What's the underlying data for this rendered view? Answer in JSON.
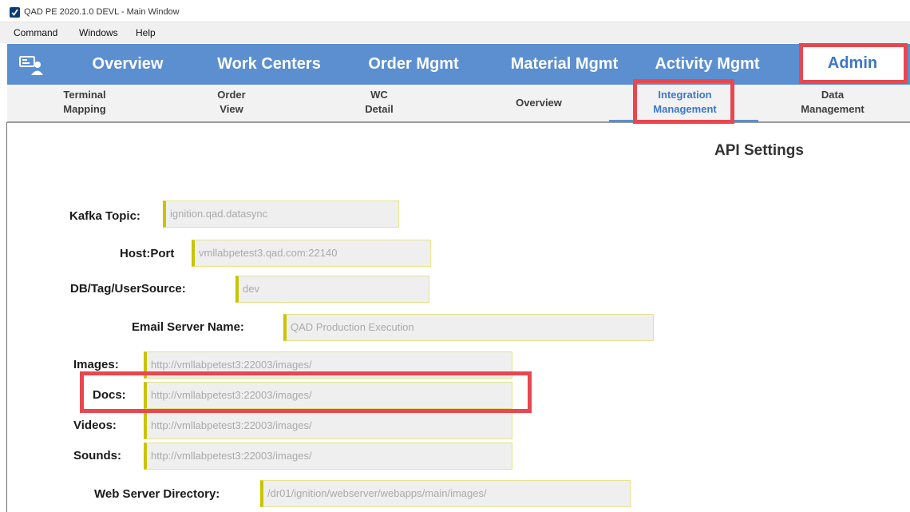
{
  "window": {
    "title": "QAD PE 2020.1.0 DEVL - Main Window"
  },
  "menu": [
    "Command",
    "Windows",
    "Help"
  ],
  "top_nav": {
    "tabs": [
      "Overview",
      "Work Centers",
      "Order Mgmt",
      "Material Mgmt",
      "Activity Mgmt"
    ],
    "active": "Admin"
  },
  "sub_nav": {
    "tabs": [
      {
        "line1": "Terminal",
        "line2": "Mapping"
      },
      {
        "line1": "Order",
        "line2": "View"
      },
      {
        "line1": "WC",
        "line2": "Detail"
      },
      {
        "line1": "Overview",
        "line2": ""
      },
      {
        "line1": "Integration",
        "line2": "Management"
      },
      {
        "line1": "Data",
        "line2": "Management"
      }
    ],
    "active_index": 4
  },
  "page": {
    "title": "API Settings"
  },
  "form": {
    "kafka_topic": {
      "label": "Kafka Topic:",
      "value": "ignition.qad.datasync"
    },
    "host_port": {
      "label": "Host:Port",
      "value": "vmllabpetest3.qad.com:22140"
    },
    "db_tag_usersource": {
      "label": "DB/Tag/UserSource:",
      "value": "dev"
    },
    "email_server_name": {
      "label": "Email Server Name:",
      "value": "QAD Production Execution"
    },
    "images": {
      "label": "Images:",
      "value": "http://vmllabpetest3:22003/images/"
    },
    "docs": {
      "label": "Docs:",
      "value": "http://vmllabpetest3:22003/images/"
    },
    "videos": {
      "label": "Videos:",
      "value": "http://vmllabpetest3:22003/images/"
    },
    "sounds": {
      "label": "Sounds:",
      "value": "http://vmllabpetest3:22003/images/"
    },
    "web_server_directory": {
      "label": "Web Server Directory:",
      "value": "/dr01/ignition/webserver/webapps/main/images/"
    }
  },
  "colors": {
    "nav_bg": "#5b8fd0",
    "highlight_box": "#e8474f",
    "field_accent": "#c8c400"
  }
}
